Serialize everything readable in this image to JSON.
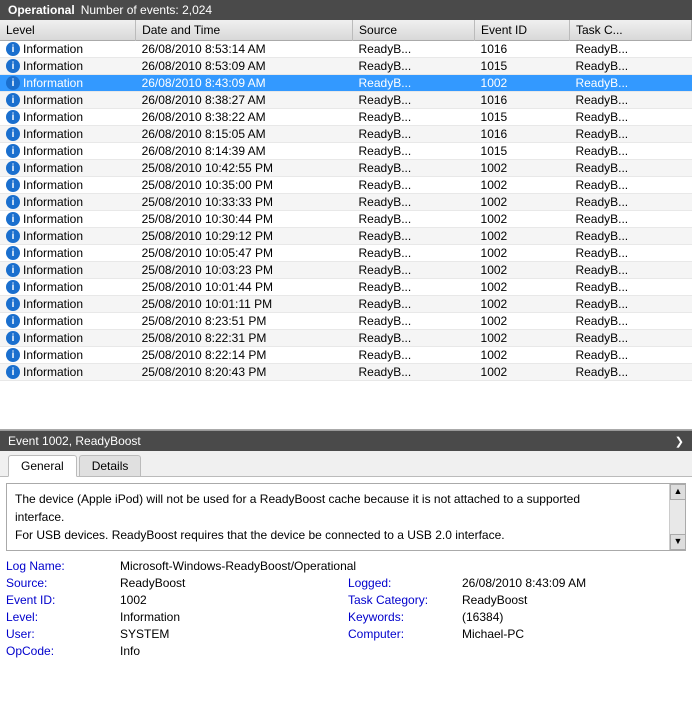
{
  "header": {
    "title": "Operational",
    "event_count_label": "Number of events: 2,024"
  },
  "table": {
    "columns": [
      "Level",
      "Date and Time",
      "Source",
      "Event ID",
      "Task C..."
    ],
    "rows": [
      {
        "level": "Information",
        "datetime": "26/08/2010 8:53:14 AM",
        "source": "ReadyB...",
        "eventid": "1016",
        "task": "ReadyB..."
      },
      {
        "level": "Information",
        "datetime": "26/08/2010 8:53:09 AM",
        "source": "ReadyB...",
        "eventid": "1015",
        "task": "ReadyB..."
      },
      {
        "level": "Information",
        "datetime": "26/08/2010 8:43:09 AM",
        "source": "ReadyB...",
        "eventid": "1002",
        "task": "ReadyB...",
        "selected": true
      },
      {
        "level": "Information",
        "datetime": "26/08/2010 8:38:27 AM",
        "source": "ReadyB...",
        "eventid": "1016",
        "task": "ReadyB..."
      },
      {
        "level": "Information",
        "datetime": "26/08/2010 8:38:22 AM",
        "source": "ReadyB...",
        "eventid": "1015",
        "task": "ReadyB..."
      },
      {
        "level": "Information",
        "datetime": "26/08/2010 8:15:05 AM",
        "source": "ReadyB...",
        "eventid": "1016",
        "task": "ReadyB..."
      },
      {
        "level": "Information",
        "datetime": "26/08/2010 8:14:39 AM",
        "source": "ReadyB...",
        "eventid": "1015",
        "task": "ReadyB..."
      },
      {
        "level": "Information",
        "datetime": "25/08/2010 10:42:55 PM",
        "source": "ReadyB...",
        "eventid": "1002",
        "task": "ReadyB..."
      },
      {
        "level": "Information",
        "datetime": "25/08/2010 10:35:00 PM",
        "source": "ReadyB...",
        "eventid": "1002",
        "task": "ReadyB..."
      },
      {
        "level": "Information",
        "datetime": "25/08/2010 10:33:33 PM",
        "source": "ReadyB...",
        "eventid": "1002",
        "task": "ReadyB..."
      },
      {
        "level": "Information",
        "datetime": "25/08/2010 10:30:44 PM",
        "source": "ReadyB...",
        "eventid": "1002",
        "task": "ReadyB..."
      },
      {
        "level": "Information",
        "datetime": "25/08/2010 10:29:12 PM",
        "source": "ReadyB...",
        "eventid": "1002",
        "task": "ReadyB..."
      },
      {
        "level": "Information",
        "datetime": "25/08/2010 10:05:47 PM",
        "source": "ReadyB...",
        "eventid": "1002",
        "task": "ReadyB..."
      },
      {
        "level": "Information",
        "datetime": "25/08/2010 10:03:23 PM",
        "source": "ReadyB...",
        "eventid": "1002",
        "task": "ReadyB..."
      },
      {
        "level": "Information",
        "datetime": "25/08/2010 10:01:44 PM",
        "source": "ReadyB...",
        "eventid": "1002",
        "task": "ReadyB..."
      },
      {
        "level": "Information",
        "datetime": "25/08/2010 10:01:11 PM",
        "source": "ReadyB...",
        "eventid": "1002",
        "task": "ReadyB..."
      },
      {
        "level": "Information",
        "datetime": "25/08/2010 8:23:51 PM",
        "source": "ReadyB...",
        "eventid": "1002",
        "task": "ReadyB..."
      },
      {
        "level": "Information",
        "datetime": "25/08/2010 8:22:31 PM",
        "source": "ReadyB...",
        "eventid": "1002",
        "task": "ReadyB..."
      },
      {
        "level": "Information",
        "datetime": "25/08/2010 8:22:14 PM",
        "source": "ReadyB...",
        "eventid": "1002",
        "task": "ReadyB..."
      },
      {
        "level": "Information",
        "datetime": "25/08/2010 8:20:43 PM",
        "source": "ReadyB...",
        "eventid": "1002",
        "task": "ReadyB..."
      }
    ]
  },
  "event_detail": {
    "title": "Event 1002, ReadyBoost",
    "tabs": [
      "General",
      "Details"
    ],
    "active_tab": "General",
    "message_line1": "The device (Apple iPod) will not be used for a ReadyBoost cache because it is not attached to a supported",
    "message_line2": "interface.",
    "message_line3": "    For USB devices. ReadyBoost requires that the device be connected to a USB 2.0 interface.",
    "properties": {
      "log_name_label": "Log Name:",
      "log_name_value": "Microsoft-Windows-ReadyBoost/Operational",
      "source_label": "Source:",
      "source_value": "ReadyBoost",
      "logged_label": "Logged:",
      "logged_value": "26/08/2010 8:43:09 AM",
      "event_id_label": "Event ID:",
      "event_id_value": "1002",
      "task_cat_label": "Task Category:",
      "task_cat_value": "ReadyBoost",
      "level_label": "Level:",
      "level_value": "Information",
      "keywords_label": "Keywords:",
      "keywords_value": "(16384)",
      "user_label": "User:",
      "user_value": "SYSTEM",
      "computer_label": "Computer:",
      "computer_value": "Michael-PC",
      "opcode_label": "OpCode:",
      "opcode_value": "Info"
    }
  }
}
